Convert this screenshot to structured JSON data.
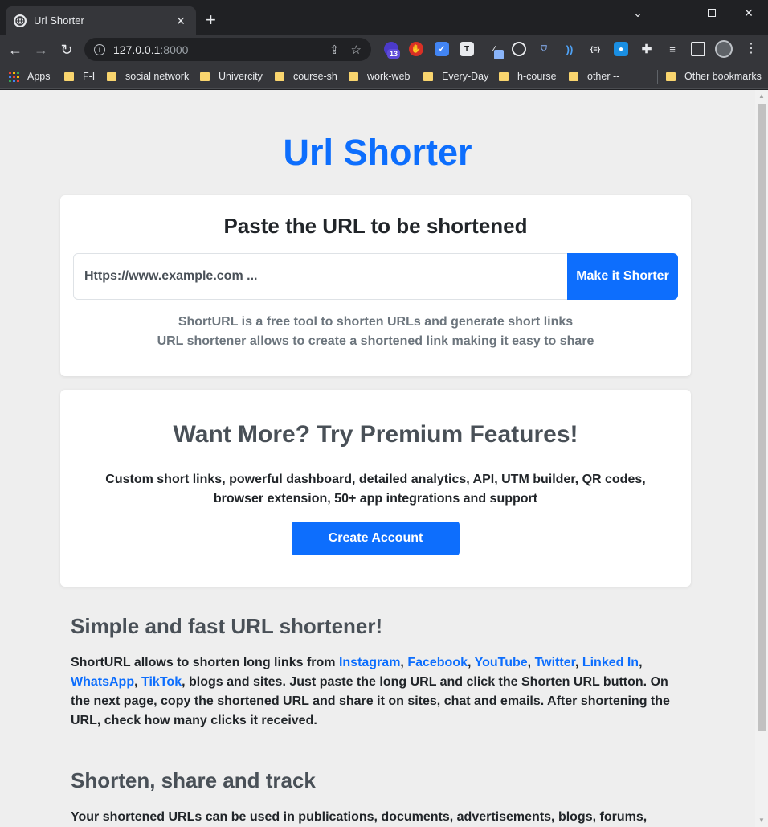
{
  "browser": {
    "tab_title": "Url Shorter",
    "new_tab_symbol": "+",
    "close_symbol": "×",
    "url_host": "127.0.0.1",
    "url_port": ":8000",
    "extension_badge": "13",
    "bookmarks": [
      {
        "label": "Apps",
        "icon": "apps-grid-icon"
      },
      {
        "label": "F-I",
        "icon": "folder-icon"
      },
      {
        "label": "social network",
        "icon": "folder-icon"
      },
      {
        "label": "Univercity",
        "icon": "folder-icon"
      },
      {
        "label": "course-sh",
        "icon": "folder-icon"
      },
      {
        "label": "work-web",
        "icon": "folder-icon"
      },
      {
        "label": "Every-Day",
        "icon": "folder-icon"
      },
      {
        "label": "h-course",
        "icon": "folder-icon"
      },
      {
        "label": "other --",
        "icon": "folder-icon"
      }
    ],
    "other_bookmarks": "Other bookmarks"
  },
  "page": {
    "title": "Url Shorter",
    "shorten_card": {
      "heading": "Paste the URL to be shortened",
      "input_placeholder": "Https://www.example.com ...",
      "button_label": "Make it Shorter",
      "desc_line1": "ShortURL is a free tool to shorten URLs and generate short links",
      "desc_line2": "URL shortener allows to create a shortened link making it easy to share"
    },
    "premium_card": {
      "heading": "Want More? Try Premium Features!",
      "description": "Custom short links, powerful dashboard, detailed analytics, API, UTM builder, QR codes, browser extension, 50+ app integrations and support",
      "button_label": "Create Account"
    },
    "section_simple": {
      "heading": "Simple and fast URL shortener!",
      "intro": "ShortURL allows to shorten long links from ",
      "links": [
        "Instagram",
        "Facebook",
        "YouTube",
        "Twitter",
        "Linked In",
        "WhatsApp",
        "TikTok"
      ],
      "outro": ", blogs and sites. Just paste the long URL and click the Shorten URL button. On the next page, copy the shortened URL and share it on sites, chat and emails. After shortening the URL, check how many clicks it received."
    },
    "section_share": {
      "heading": "Shorten, share and track",
      "text": "Your shortened URLs can be used in publications, documents, advertisements, blogs, forums, instant"
    }
  },
  "colors": {
    "accent": "#0d6efd",
    "page_bg": "#eeeeee",
    "chrome_bg": "#35363a",
    "folder": "#f9d56e"
  }
}
